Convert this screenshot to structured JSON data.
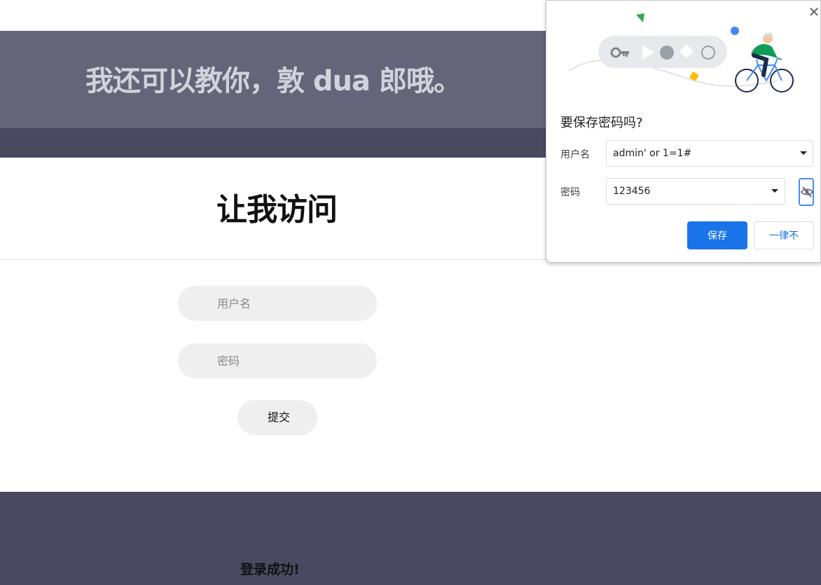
{
  "page": {
    "hero_title": "我还可以教你，敦 dua 郎哦。",
    "section_title": "让我访问",
    "username_placeholder": "用户名",
    "password_placeholder": "密码",
    "submit_label": "提交",
    "footer_message": "登录成功!"
  },
  "save_password_popup": {
    "close_glyph": "✕",
    "title": "要保存密码吗?",
    "username_label": "用户名",
    "username_value": "admin' or 1=1#",
    "password_label": "密码",
    "password_value": "123456",
    "save_label": "保存",
    "never_label": "一律不",
    "icons": [
      "key-icon",
      "eye-off-icon",
      "chevron-down-icon",
      "close-icon"
    ],
    "accent_color": "#1a73e8"
  },
  "colors": {
    "hero_background": "#656479",
    "band_background": "#4a4960",
    "hero_text": "#d3d2dc",
    "input_background": "#efefef"
  }
}
